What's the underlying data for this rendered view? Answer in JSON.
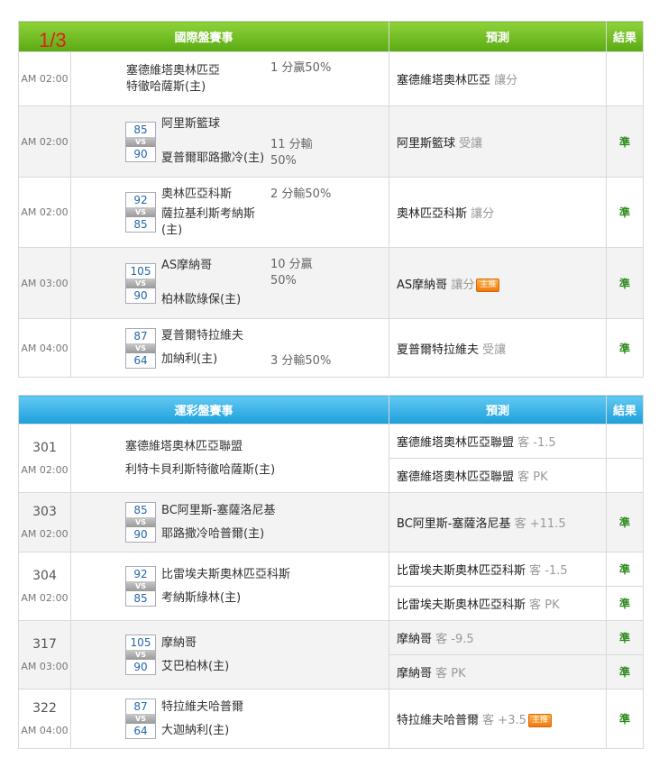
{
  "page_counter": "1/3",
  "intl": {
    "header": {
      "match": "國際盤賽事",
      "prediction": "預測",
      "result": "結果"
    },
    "rows": [
      {
        "time": "AM 02:00",
        "score_a": "",
        "score_b": "",
        "team_a": "塞德維塔奧林匹亞",
        "team_b": "特徹哈薩斯(主)",
        "handicap": "1 分贏50%",
        "pred_team": "塞德維塔奧林匹亞",
        "pred_side": "讓分",
        "badge": "",
        "result": ""
      },
      {
        "time": "AM 02:00",
        "score_a": "85",
        "score_b": "90",
        "team_a": "阿里斯籃球",
        "team_b": "夏普爾耶路撒冷(主)",
        "handicap": "11 分輸 50%",
        "pred_team": "阿里斯籃球",
        "pred_side": "受讓",
        "badge": "",
        "result": "準"
      },
      {
        "time": "AM 02:00",
        "score_a": "92",
        "score_b": "85",
        "team_a": "奧林匹亞科斯",
        "team_b": "薩拉基利斯考納斯(主)",
        "handicap": "2 分輸50%",
        "pred_team": "奧林匹亞科斯",
        "pred_side": "讓分",
        "badge": "",
        "result": "準"
      },
      {
        "time": "AM 03:00",
        "score_a": "105",
        "score_b": "90",
        "team_a": "AS摩納哥",
        "team_b": "柏林歐綠保(主)",
        "handicap": "10 分贏 50%",
        "pred_team": "AS摩納哥",
        "pred_side": "讓分",
        "badge": "主推",
        "result": "準"
      },
      {
        "time": "AM 04:00",
        "score_a": "87",
        "score_b": "64",
        "team_a": "夏普爾特拉維夫",
        "team_b": "加納利(主)",
        "handicap": "3 分輸50%",
        "pred_team": "夏普爾特拉維夫",
        "pred_side": "受讓",
        "badge": "",
        "result": "準"
      }
    ]
  },
  "lottery": {
    "header": {
      "match": "運彩盤賽事",
      "prediction": "預測",
      "result": "結果"
    },
    "rows": [
      {
        "num": "301",
        "time": "AM 02:00",
        "score_a": "",
        "score_b": "",
        "team_a": "塞德維塔奧林匹亞聯盟",
        "team_b": "利特卡貝利斯特徹哈薩斯(主)",
        "preds": [
          {
            "team": "塞德維塔奧林匹亞聯盟",
            "side": "客 -1.5",
            "badge": "",
            "result": ""
          },
          {
            "team": "塞德維塔奧林匹亞聯盟",
            "side": "客 PK",
            "badge": "",
            "result": ""
          }
        ]
      },
      {
        "num": "303",
        "time": "AM 02:00",
        "score_a": "85",
        "score_b": "90",
        "team_a": "BC阿里斯-塞薩洛尼基",
        "team_b": "耶路撒冷哈普爾(主)",
        "preds": [
          {
            "team": "BC阿里斯-塞薩洛尼基",
            "side": "客 +11.5",
            "badge": "",
            "result": "準"
          }
        ]
      },
      {
        "num": "304",
        "time": "AM 02:00",
        "score_a": "92",
        "score_b": "85",
        "team_a": "比雷埃夫斯奧林匹亞科斯",
        "team_b": "考納斯綠林(主)",
        "preds": [
          {
            "team": "比雷埃夫斯奧林匹亞科斯",
            "side": "客 -1.5",
            "badge": "",
            "result": "準"
          },
          {
            "team": "比雷埃夫斯奧林匹亞科斯",
            "side": "客 PK",
            "badge": "",
            "result": "準"
          }
        ]
      },
      {
        "num": "317",
        "time": "AM 03:00",
        "score_a": "105",
        "score_b": "90",
        "team_a": "摩納哥",
        "team_b": "艾巴柏林(主)",
        "preds": [
          {
            "team": "摩納哥",
            "side": "客 -9.5",
            "badge": "",
            "result": "準"
          },
          {
            "team": "摩納哥",
            "side": "客 PK",
            "badge": "",
            "result": "準"
          }
        ]
      },
      {
        "num": "322",
        "time": "AM 04:00",
        "score_a": "87",
        "score_b": "64",
        "team_a": "特拉維夫哈普爾",
        "team_b": "大迦納利(主)",
        "preds": [
          {
            "team": "特拉維夫哈普爾",
            "side": "客 +3.5",
            "badge": "主推",
            "result": "準"
          }
        ]
      }
    ]
  },
  "vs_label": "VS",
  "colors": {
    "green_header": "#5aaa12",
    "blue_header": "#1c9fda",
    "result_green": "#2e8b1e",
    "counter_red": "#e0201c"
  }
}
